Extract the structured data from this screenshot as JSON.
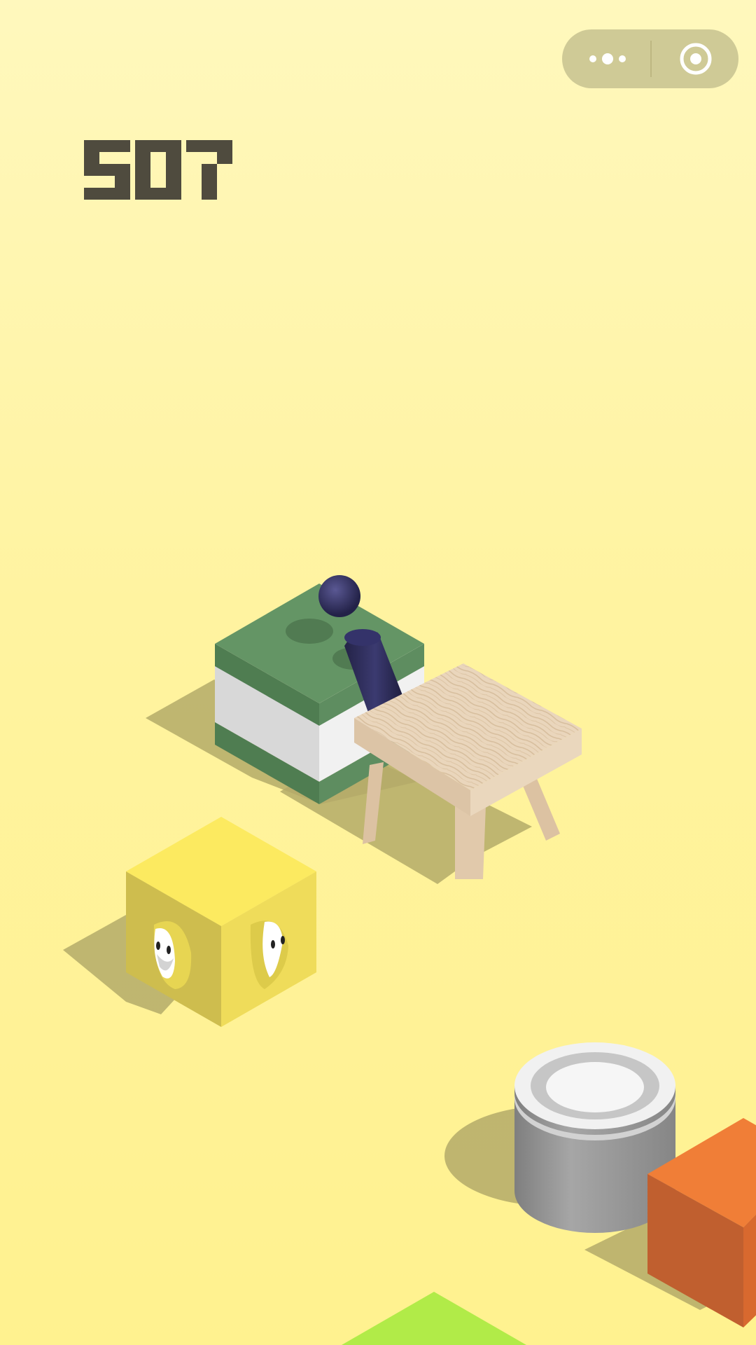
{
  "game": {
    "score": "507"
  },
  "capsule": {
    "menu_icon": "more-dots-icon",
    "close_icon": "target-circle-icon"
  },
  "colors": {
    "background": "#fff4a6",
    "score": "#4f4b3e",
    "capsule": "#cfca96",
    "green_block": "#649565",
    "yellow_cube": "#fcea60",
    "cylinder": "#8d8d8d",
    "orange_block": "#f07e37",
    "stool_wood": "#e6cfb4",
    "player": "#2f2c55",
    "lime_block": "#b1eb48"
  }
}
